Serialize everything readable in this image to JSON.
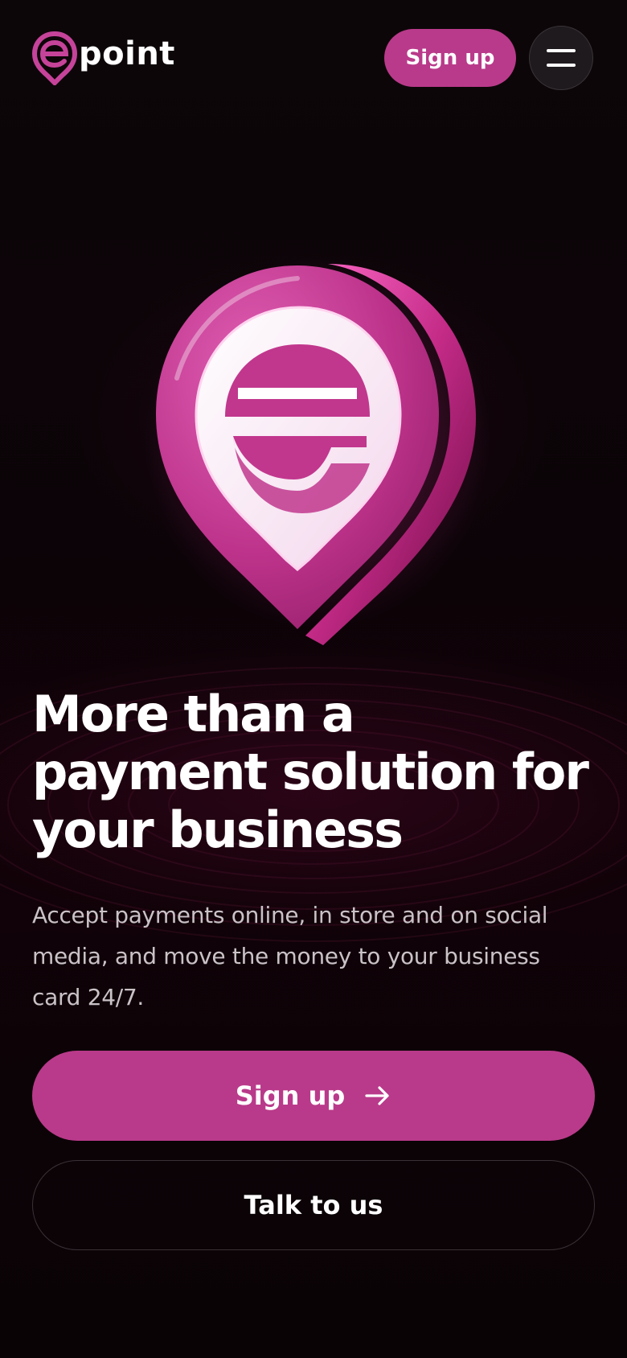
{
  "brand": {
    "name": "point",
    "logo_icon": "epoint-pin-logo-icon",
    "accent_color": "#b93a8a",
    "background_color": "#0a0208"
  },
  "header": {
    "signup_label": "Sign up",
    "menu_icon": "hamburger-menu-icon"
  },
  "hero": {
    "image_icon": "epoint-3d-pin-icon",
    "headline": "More than a payment solution for your business",
    "subtext": "Accept payments online, in store and on social media, and move the money to your business card 24/7."
  },
  "actions": {
    "signup_label": "Sign up",
    "signup_icon": "arrow-right-icon",
    "talk_label": "Talk to us"
  }
}
